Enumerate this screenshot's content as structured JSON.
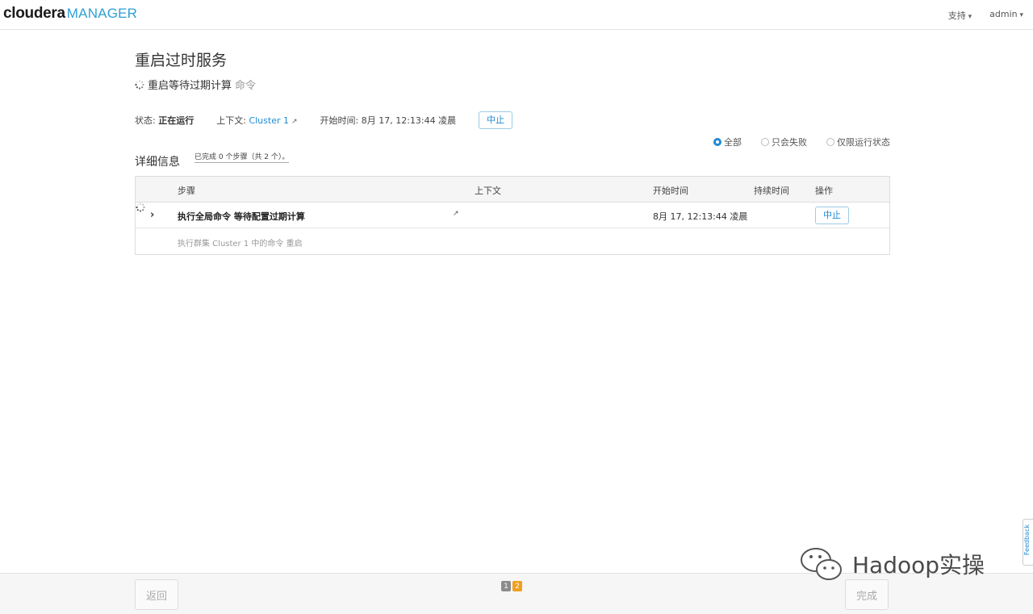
{
  "header": {
    "brand": "cloudera",
    "product": "MANAGER",
    "support": "支持",
    "user": "admin"
  },
  "page": {
    "title": "重启过时服务",
    "command_name": "重启等待过期计算",
    "command_suffix": "命令"
  },
  "status": {
    "state_label": "状态:",
    "state_value": "正在运行",
    "context_label": "上下文:",
    "context_link": "Cluster 1",
    "start_time_label": "开始时间:",
    "start_time_value": "8月 17, 12:13:44 凌晨",
    "abort_button": "中止"
  },
  "filters": {
    "options": [
      "全部",
      "只会失败",
      "仅限运行状态"
    ],
    "selected": "全部"
  },
  "details": {
    "heading": "详细信息",
    "progress": "已完成 0 个步骤（共 2 个）。"
  },
  "table": {
    "columns": [
      "步骤",
      "上下文",
      "开始时间",
      "持续时间",
      "操作"
    ],
    "rows": [
      {
        "step": "执行全局命令 等待配置过期计算",
        "start_time": "8月 17, 12:13:44 凌晨",
        "duration": "",
        "action": "中止"
      }
    ],
    "subrow": "执行群集 Cluster 1 中的命令 重启"
  },
  "footer": {
    "back_button": "返回",
    "finish_button": "完成",
    "pages": [
      "1",
      "2"
    ]
  },
  "feedback": "Feedback",
  "watermark": "Hadoop实操",
  "colors": {
    "accent": "#1f8ad4",
    "logo_blue": "#2e9fd3",
    "page_current": "#f0a01e"
  }
}
